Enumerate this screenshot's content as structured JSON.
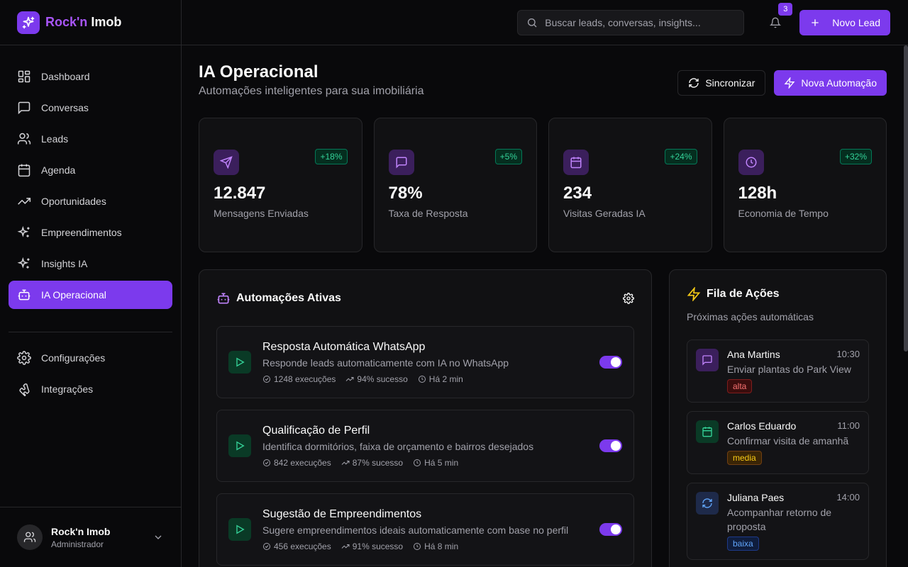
{
  "brand": {
    "name_part1": "Rock'n",
    "name_part2": "Imob"
  },
  "nav": [
    {
      "label": "Dashboard",
      "icon": "dashboard-icon"
    },
    {
      "label": "Conversas",
      "icon": "chat-icon"
    },
    {
      "label": "Leads",
      "icon": "users-icon"
    },
    {
      "label": "Agenda",
      "icon": "calendar-icon"
    },
    {
      "label": "Oportunidades",
      "icon": "trend-icon"
    },
    {
      "label": "Empreendimentos",
      "icon": "sparkles-icon"
    },
    {
      "label": "Insights IA",
      "icon": "sparkles-icon"
    },
    {
      "label": "IA Operacional",
      "icon": "bot-icon",
      "active": true
    }
  ],
  "nav2": [
    {
      "label": "Configurações",
      "icon": "gear-icon"
    },
    {
      "label": "Integrações",
      "icon": "puzzle-icon"
    }
  ],
  "user": {
    "name": "Rock'n Imob",
    "role": "Administrador"
  },
  "topbar": {
    "search_placeholder": "Buscar leads, conversas, insights...",
    "notifications": "3",
    "new_lead": "Novo Lead"
  },
  "page": {
    "title": "IA Operacional",
    "subtitle": "Automações inteligentes para sua imobiliária",
    "sync": "Sincronizar",
    "new_automation": "Nova Automação"
  },
  "stats": [
    {
      "value": "12.847",
      "label": "Mensagens Enviadas",
      "delta": "+18%",
      "icon": "send-icon"
    },
    {
      "value": "78%",
      "label": "Taxa de Resposta",
      "delta": "+5%",
      "icon": "chat-icon"
    },
    {
      "value": "234",
      "label": "Visitas Geradas IA",
      "delta": "+24%",
      "icon": "calendar-icon"
    },
    {
      "value": "128h",
      "label": "Economia de Tempo",
      "delta": "+32%",
      "icon": "clock-icon"
    }
  ],
  "automations": {
    "title": "Automações Ativas",
    "items": [
      {
        "title": "Resposta Automática WhatsApp",
        "desc": "Responde leads automaticamente com IA no WhatsApp",
        "executions": "1248 execuções",
        "success": "94% sucesso",
        "time": "Há 2 min",
        "enabled": true
      },
      {
        "title": "Qualificação de Perfil",
        "desc": "Identifica dormitórios, faixa de orçamento e bairros desejados",
        "executions": "842 execuções",
        "success": "87% sucesso",
        "time": "Há 5 min",
        "enabled": true
      },
      {
        "title": "Sugestão de Empreendimentos",
        "desc": "Sugere empreendimentos ideais automaticamente com base no perfil",
        "executions": "456 execuções",
        "success": "91% sucesso",
        "time": "Há 8 min",
        "enabled": true
      }
    ]
  },
  "queue": {
    "title": "Fila de Ações",
    "subtitle": "Próximas ações automáticas",
    "items": [
      {
        "name": "Ana Martins",
        "time": "10:30",
        "text": "Enviar plantas do Park View",
        "priority": "alta",
        "icon": "chat-icon"
      },
      {
        "name": "Carlos Eduardo",
        "time": "11:00",
        "text": "Confirmar visita de amanhã",
        "priority": "media",
        "icon": "calendar-icon"
      },
      {
        "name": "Juliana Paes",
        "time": "14:00",
        "text": "Acompanhar retorno de proposta",
        "priority": "baixa",
        "icon": "refresh-icon"
      }
    ]
  },
  "colors": {
    "accent": "#7c3aed",
    "success": "#34d399",
    "high": "#f87171",
    "medium": "#facc15",
    "low": "#60a5fa"
  }
}
